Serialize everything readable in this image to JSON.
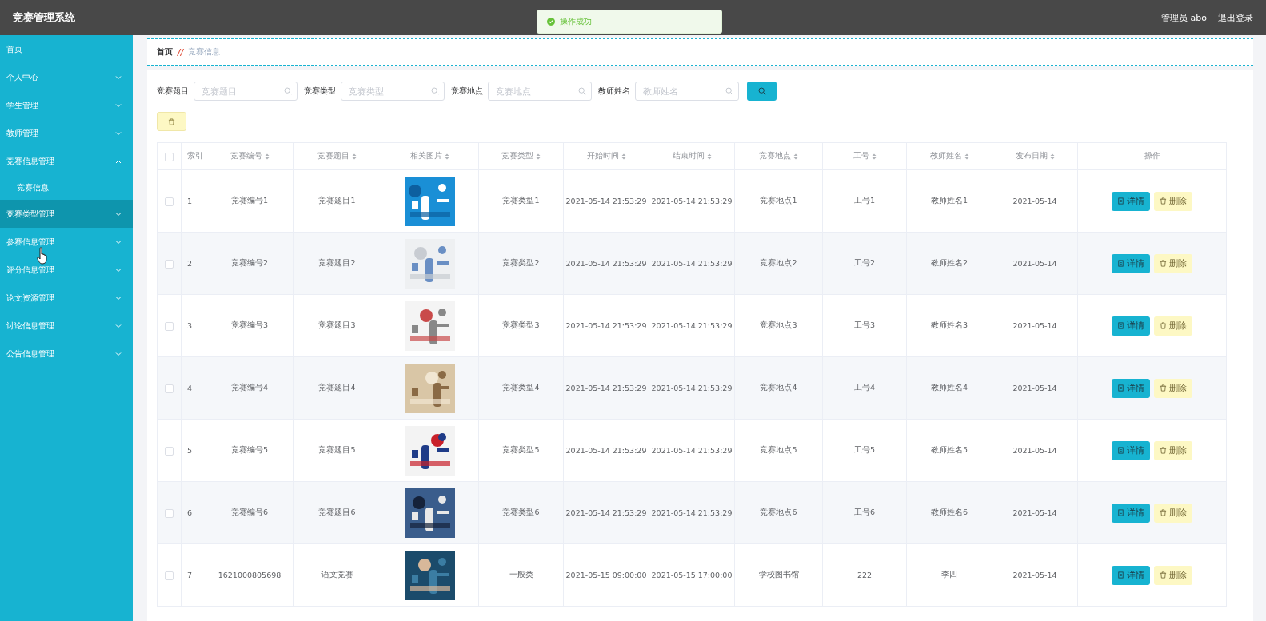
{
  "header": {
    "title": "竞赛管理系统",
    "user": "管理员 abo",
    "logout": "退出登录"
  },
  "toast": {
    "text": "操作成功"
  },
  "sidebar": {
    "items": [
      {
        "label": "首页",
        "kind": "link",
        "selected": false
      },
      {
        "label": "个人中心",
        "kind": "menu",
        "expanded": false,
        "selected": false
      },
      {
        "label": "学生管理",
        "kind": "menu",
        "expanded": false,
        "selected": false
      },
      {
        "label": "教师管理",
        "kind": "menu",
        "expanded": false,
        "selected": false
      },
      {
        "label": "竞赛信息管理",
        "kind": "menu",
        "expanded": true,
        "selected": false,
        "children": [
          {
            "label": "竞赛信息",
            "selected": false
          }
        ]
      },
      {
        "label": "竞赛类型管理",
        "kind": "menu",
        "expanded": false,
        "selected": true
      },
      {
        "label": "参赛信息管理",
        "kind": "menu",
        "expanded": false,
        "selected": false
      },
      {
        "label": "评分信息管理",
        "kind": "menu",
        "expanded": false,
        "selected": false
      },
      {
        "label": "论文资源管理",
        "kind": "menu",
        "expanded": false,
        "selected": false
      },
      {
        "label": "讨论信息管理",
        "kind": "menu",
        "expanded": false,
        "selected": false
      },
      {
        "label": "公告信息管理",
        "kind": "menu",
        "expanded": false,
        "selected": false
      }
    ]
  },
  "breadcrumb": {
    "home": "首页",
    "separator": "//",
    "current": "竞赛信息"
  },
  "filters": [
    {
      "label": "竞赛题目",
      "placeholder": "竞赛题目"
    },
    {
      "label": "竞赛类型",
      "placeholder": "竞赛类型"
    },
    {
      "label": "竞赛地点",
      "placeholder": "竞赛地点"
    },
    {
      "label": "教师姓名",
      "placeholder": "教师姓名"
    }
  ],
  "table": {
    "all_checked": false,
    "columns": [
      {
        "label": "索引",
        "sortable": false
      },
      {
        "label": "竞赛编号",
        "sortable": true
      },
      {
        "label": "竞赛题目",
        "sortable": true
      },
      {
        "label": "相关图片",
        "sortable": true
      },
      {
        "label": "竞赛类型",
        "sortable": true
      },
      {
        "label": "开始时间",
        "sortable": true
      },
      {
        "label": "结束时间",
        "sortable": true
      },
      {
        "label": "竞赛地点",
        "sortable": true
      },
      {
        "label": "工号",
        "sortable": true
      },
      {
        "label": "教师姓名",
        "sortable": true
      },
      {
        "label": "发布日期",
        "sortable": true
      },
      {
        "label": "操作",
        "sortable": false
      }
    ],
    "rows": [
      {
        "checked": false,
        "cells": [
          "1",
          "竞赛编号1",
          "竞赛题目1",
          {
            "kind": "picture"
          },
          "竞赛类型1",
          "2021-05-14 21:53:29",
          "2021-05-14 21:53:29",
          "竞赛地点1",
          "工号1",
          "教师姓名1",
          "2021-05-14"
        ],
        "actions": [
          "详情",
          "删除"
        ]
      },
      {
        "checked": false,
        "cells": [
          "2",
          "竞赛编号2",
          "竞赛题目2",
          {
            "kind": "picture"
          },
          "竞赛类型2",
          "2021-05-14 21:53:29",
          "2021-05-14 21:53:29",
          "竞赛地点2",
          "工号2",
          "教师姓名2",
          "2021-05-14"
        ],
        "actions": [
          "详情",
          "删除"
        ]
      },
      {
        "checked": false,
        "cells": [
          "3",
          "竞赛编号3",
          "竞赛题目3",
          {
            "kind": "picture"
          },
          "竞赛类型3",
          "2021-05-14 21:53:29",
          "2021-05-14 21:53:29",
          "竞赛地点3",
          "工号3",
          "教师姓名3",
          "2021-05-14"
        ],
        "actions": [
          "详情",
          "删除"
        ]
      },
      {
        "checked": false,
        "cells": [
          "4",
          "竞赛编号4",
          "竞赛题目4",
          {
            "kind": "picture"
          },
          "竞赛类型4",
          "2021-05-14 21:53:29",
          "2021-05-14 21:53:29",
          "竞赛地点4",
          "工号4",
          "教师姓名4",
          "2021-05-14"
        ],
        "actions": [
          "详情",
          "删除"
        ]
      },
      {
        "checked": false,
        "cells": [
          "5",
          "竞赛编号5",
          "竞赛题目5",
          {
            "kind": "picture"
          },
          "竞赛类型5",
          "2021-05-14 21:53:29",
          "2021-05-14 21:53:29",
          "竞赛地点5",
          "工号5",
          "教师姓名5",
          "2021-05-14"
        ],
        "actions": [
          "详情",
          "删除"
        ]
      },
      {
        "checked": false,
        "cells": [
          "6",
          "竞赛编号6",
          "竞赛题目6",
          {
            "kind": "picture"
          },
          "竞赛类型6",
          "2021-05-14 21:53:29",
          "2021-05-14 21:53:29",
          "竞赛地点6",
          "工号6",
          "教师姓名6",
          "2021-05-14"
        ],
        "actions": [
          "详情",
          "删除"
        ]
      },
      {
        "checked": false,
        "cells": [
          "7",
          "1621000805698",
          "语文竞赛",
          {
            "kind": "picture"
          },
          "一般类",
          "2021-05-15 09:00:00",
          "2021-05-15 17:00:00",
          "学校图书馆",
          "222",
          "李四",
          "2021-05-14"
        ],
        "actions": [
          "详情",
          "删除"
        ]
      }
    ]
  }
}
